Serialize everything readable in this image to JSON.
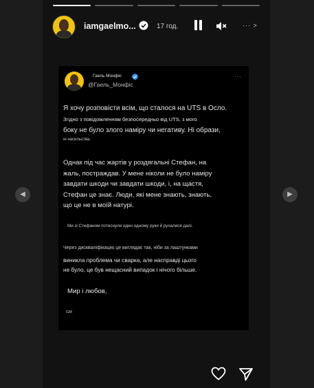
{
  "story": {
    "progress": {
      "segments": 5,
      "active_index": 0
    },
    "header": {
      "username": "iamgaelmo...",
      "timestamp": "17 год.",
      "more_label": "··· >"
    },
    "post": {
      "author_name": "Гаель Монфіс",
      "author_handle": "@Гаель_Монфіс",
      "menu_label": "···",
      "lines": [
        "Я хочу розповісти всім, що сталося на UTS в Осло.",
        "Згідно з повідомленням безпосередньо від UTS, з мого",
        "боку не було злого наміру чи негативу. Ні образи,",
        "ні насильства.",
        "Однак під час жартів у роздягальні Стефан, на",
        "жаль, постраждав. У мене ніколи не було наміру",
        "завдати шкоди чи завдати шкоди, і, на щастя,",
        "Стефан це знає. Люди, які мене знають, знають,",
        "що це не в моїй натурі.",
        "Ми зі Стефаном потиснули один одному руки й рухалися далі.",
        "Через дискваліфікацію це виглядає так, ніби за лаштунками",
        "виникла проблема чи сварка, але насправді цього",
        "не було, це був нещасний випадок і нічого більше.",
        "Мир і любов,",
        "GM"
      ]
    }
  },
  "navigation": {
    "prev_label": "◀",
    "next_label": "▶"
  },
  "icons": [
    "verified-badge-icon",
    "pause-icon",
    "mute-icon",
    "heart-icon",
    "send-icon"
  ],
  "colors": {
    "background": "#1b1b1b",
    "story_bg": "#121212",
    "card_bg": "#000000",
    "avatar_yellow": "#f3c40e",
    "verified_blue": "#3897f0"
  }
}
